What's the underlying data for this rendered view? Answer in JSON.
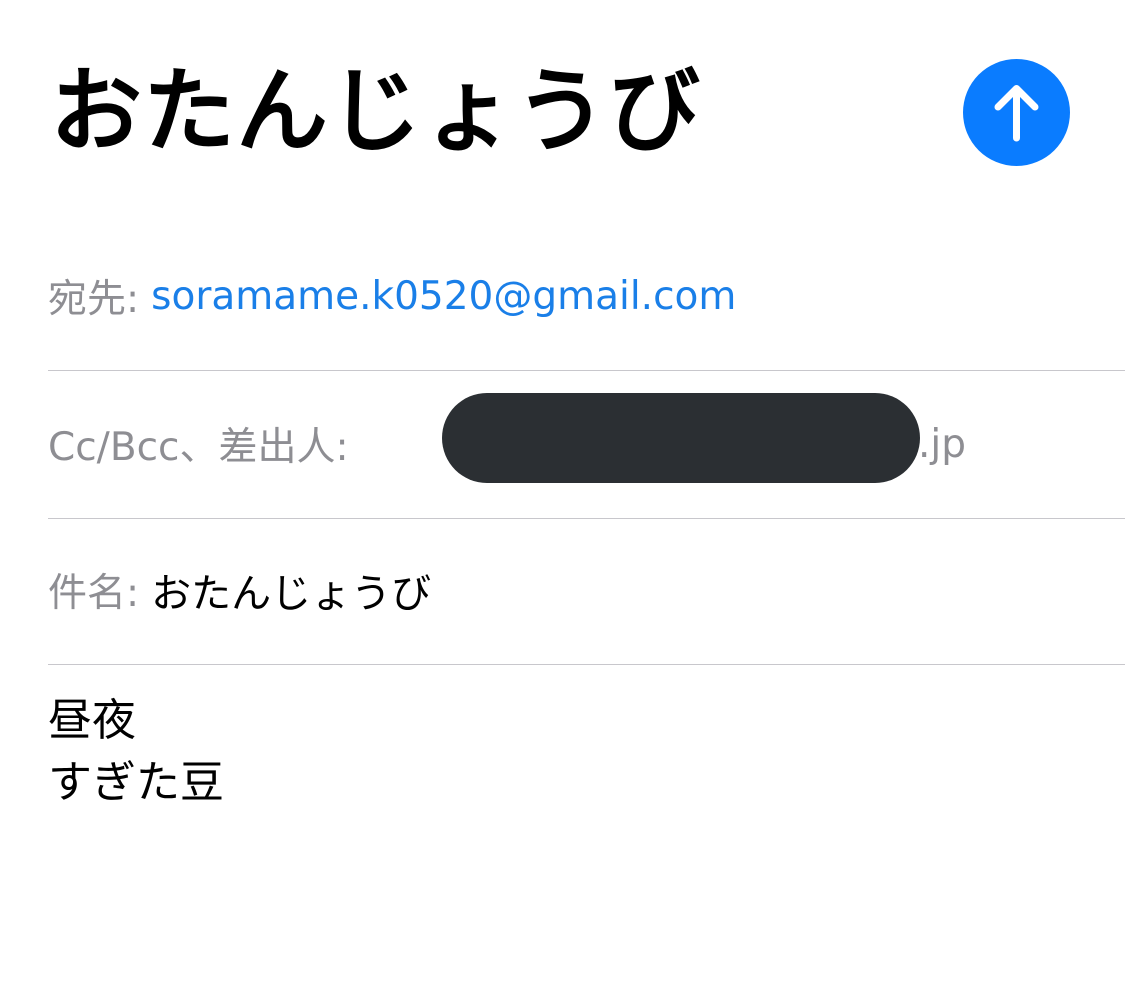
{
  "compose": {
    "title": "おたんじょうび",
    "send_button_icon": "arrow-up-icon",
    "accent_color": "#0a7cff"
  },
  "fields": {
    "to": {
      "label": "宛先:",
      "value": "soramame.k0520@gmail.com"
    },
    "cc": {
      "label": "Cc/Bcc、差出人:",
      "value_suffix": ".jp"
    },
    "subject": {
      "label": "件名:",
      "value": "おたんじょうび"
    }
  },
  "body": {
    "lines": [
      "昼夜",
      "すぎた豆"
    ]
  }
}
